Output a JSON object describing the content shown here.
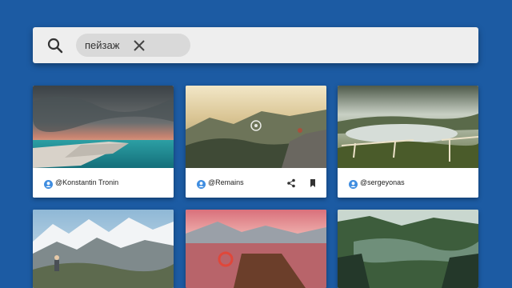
{
  "search": {
    "chip_label": "пейзаж",
    "icon": "search-icon",
    "close_icon": "close-icon"
  },
  "colors": {
    "background": "#1c5ba3",
    "search_bar": "#eeeeee",
    "chip": "#d9d9d9",
    "accent_user_icon": "#3f8de0"
  },
  "cards": [
    {
      "author": "@Konstantin Tronin"
    },
    {
      "author": "@Remains",
      "actions": [
        "share-icon",
        "bookmark-icon"
      ]
    },
    {
      "author": "@sergeyonas"
    },
    {
      "author": ""
    },
    {
      "author": ""
    },
    {
      "author": ""
    }
  ]
}
